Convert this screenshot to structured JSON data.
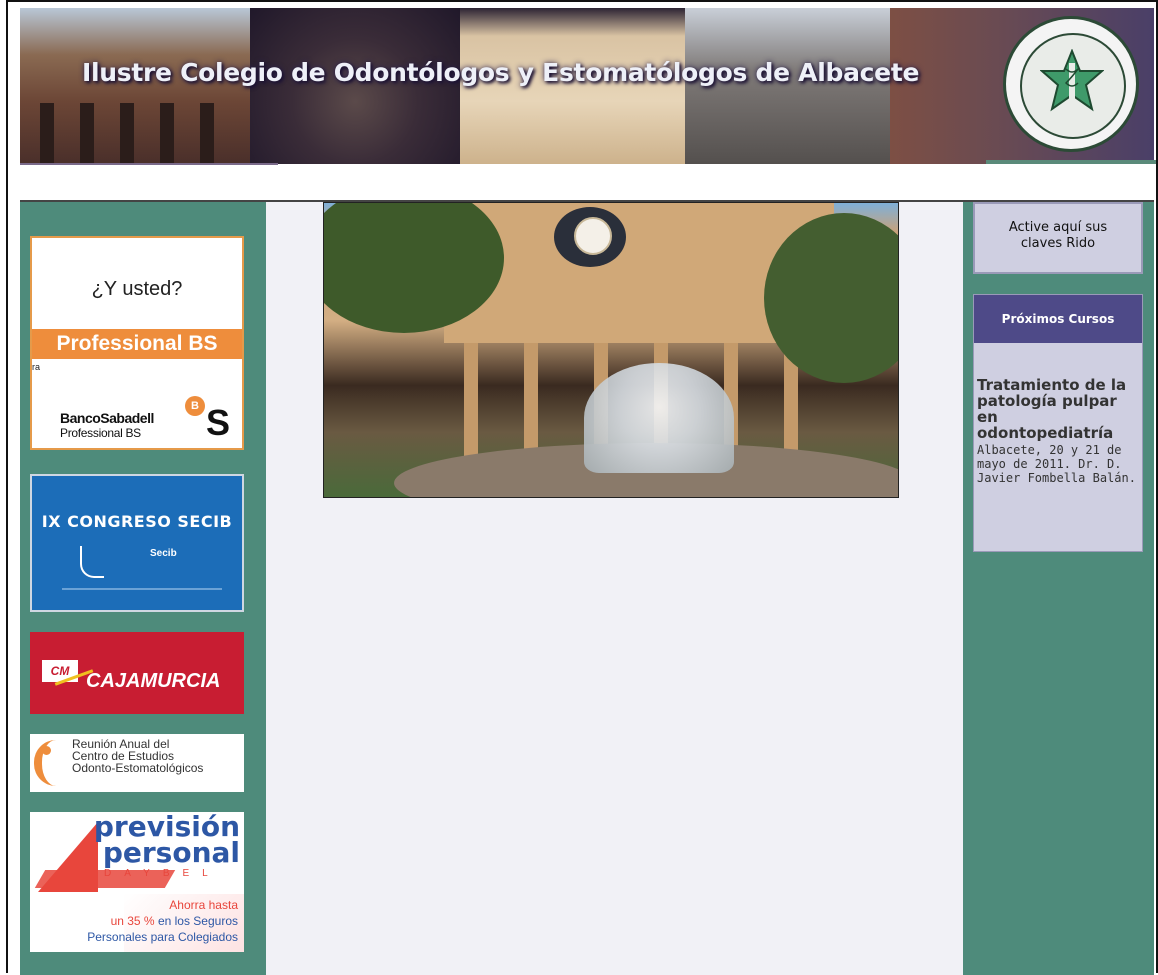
{
  "banner": {
    "title": "Ilustre Colegio de Odontólogos y Estomatólogos de Albacete",
    "logo_icon": "college-seal-logo"
  },
  "left_ads": {
    "sabadell": {
      "question": "¿Y usted?",
      "bar_label": "Professional BS",
      "small_text": "ra",
      "bank_name": "BancoSabadell",
      "bank_sub": "Professional BS",
      "circle_letter": "B",
      "big_letter": "S"
    },
    "secib": {
      "title": "IX CONGRESO SECIB",
      "small_logo": "Secib"
    },
    "cajamurcia": {
      "cm": "CM",
      "name": "CAJAMURCIA"
    },
    "reunion": {
      "line1": "Reunión Anual del",
      "line2": "Centro de Estudios",
      "line3": "Odonto-Estomatológicos"
    },
    "prevision": {
      "line1": "previsión",
      "line2": "personal",
      "brand": "DAYBEL",
      "offer1": "Ahorra hasta",
      "offer2_pct": "un 35 %",
      "offer2_rest": " en los Seguros",
      "offer3": "Personales para Colegiados"
    }
  },
  "right": {
    "rido_line1": "Active aquí sus",
    "rido_line2": "claves Rido",
    "cursos_header": "Próximos Cursos",
    "curso_title": "Tratamiento de la patología pulpar en odontopediatría",
    "curso_details": "Albacete, 20 y 21 de mayo de 2011. Dr. D. Javier Fombella Balán."
  },
  "colors": {
    "green": "#4e8b7b",
    "purple_header": "#4e4a88",
    "lavender": "#cfcfe1",
    "orange": "#ee8d3c",
    "caja_red": "#c81d32",
    "prevision_blue": "#2d57a5",
    "prevision_red": "#e8463c"
  }
}
